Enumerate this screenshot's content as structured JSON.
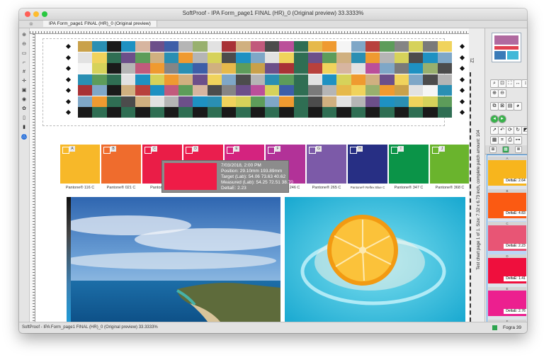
{
  "window": {
    "title": "SoftProof - IPA Form_page1 FINAL (HR)_0 (Original preview) 33.3333%",
    "tab_label": "IPA Form_page1 FINAL (HR)_0 (Original preview)",
    "tab_close": "⊗"
  },
  "colors": {
    "close": "#ff5f57",
    "minimize": "#febc2e",
    "maximize": "#28c840",
    "panel_selection": "#4aa3f0"
  },
  "chart_sheet_colors": [
    "#c9a14a",
    "#2f6e53",
    "#d7b5a0",
    "#7fa7c7",
    "#98b06e",
    "#d6d25a",
    "#c15a7c",
    "#2a8fb3",
    "#e6b94b",
    "#6c4f8a",
    "#b8413d",
    "#e2e2e2",
    "#7a7a7a",
    "#4c4c4c",
    "#1a1a1a",
    "#ef9a30",
    "#3d5ea8",
    "#5d9c5a",
    "#a83236",
    "#f0d35c",
    "#bb4f9a",
    "#1e91c2",
    "#f5f5f5",
    "#b5b5b5",
    "#858585",
    "#d0b080"
  ],
  "swatches": [
    {
      "letter": "A",
      "name": "Pantone® 116 C",
      "color": "#f7b829"
    },
    {
      "letter": "B",
      "name": "Pantone® 021 C",
      "color": "#ef6c2d"
    },
    {
      "letter": "C",
      "name": "Pantone® 1...",
      "color": "#ea1d47"
    },
    {
      "letter": "D",
      "name": "",
      "color": "#ea1e4e"
    },
    {
      "letter": "E",
      "name": "",
      "color": "#d4237f"
    },
    {
      "letter": "F",
      "name": "Pantone® 246 C",
      "color": "#b23298"
    },
    {
      "letter": "G",
      "name": "Pantone® 265 C",
      "color": "#7c5aa8"
    },
    {
      "letter": "H",
      "name": "Pantone® Reflex Blue C",
      "color": "#272f84"
    },
    {
      "letter": "I",
      "name": "Pantone® 347 C",
      "color": "#0b9448"
    },
    {
      "letter": "J",
      "name": "Pantone® 368 C",
      "color": "#6ab42d"
    }
  ],
  "tooltip": {
    "date": "7/03/2018, 2:00 PM",
    "position": "Position: 29.10mm 193.89mm",
    "target": "Target (Lab): 54.06 73.63 40.62",
    "measured": "Measured (Lab): 54.25 72.51 38.70",
    "delta": "DeltaE: 2.23",
    "color": "#ef1c47"
  },
  "side_label": "Test chart page 1 of 1. Size: 7.32 x 6.73 inch, complete patch amount: 104",
  "z_label": "Z1",
  "list_items": [
    {
      "letter": "A",
      "delta": "DeltaE: 2.64",
      "color": "#f7b51d",
      "selected": false
    },
    {
      "letter": "B",
      "delta": "DeltaE: 4.83",
      "color": "#fb5a12",
      "selected": false
    },
    {
      "letter": "C",
      "delta": "DeltaE: 2.23",
      "color": "#e85575",
      "selected": true
    },
    {
      "letter": "D",
      "delta": "DeltaE: 1.41",
      "color": "#ef0f3d",
      "selected": false
    },
    {
      "letter": "E",
      "delta": "DeltaE: 2.76",
      "color": "#ec1f8f",
      "selected": false
    },
    {
      "letter": "F",
      "delta": "",
      "color": "#c42ba9",
      "selected": false
    }
  ],
  "statusbar": {
    "text": "SoftProof - IPA Form_page1 FINAL (HR)_0 (Original preview) 33.3333%",
    "fogra": "Fogra 39"
  },
  "left_tools": [
    "zoom-in",
    "zoom-out",
    "rectangle-select",
    "crop",
    "hash-grid",
    "crosshair",
    "lock",
    "eye",
    "color-wheel",
    "book",
    "bar-chart",
    "info"
  ],
  "right_tools": [
    "zoom-fit",
    "zoom-box",
    "fullscreen",
    "arrows-horizontal",
    "arrows-vertical",
    "zoom-in-alt",
    "zoom-out-alt",
    "copy",
    "delete",
    "note",
    "color-wheel",
    "green-left",
    "green-right",
    "pointer",
    "undo",
    "sync",
    "rotate",
    "crop-image",
    "grid-tool",
    "snap",
    "print",
    "spectro"
  ]
}
